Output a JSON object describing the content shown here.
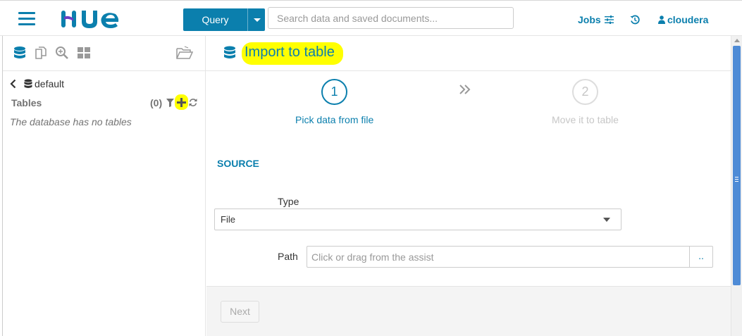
{
  "nav": {
    "query_label": "Query",
    "search_placeholder": "Search data and saved documents...",
    "jobs_label": "Jobs",
    "user_name": "cloudera"
  },
  "assist": {
    "database_name": "default",
    "tables_label": "Tables",
    "tables_count": "(0)",
    "empty_message": "The database has no tables"
  },
  "page": {
    "title": "Import to table"
  },
  "steps": [
    {
      "number": "1",
      "label": "Pick data from file",
      "active": true
    },
    {
      "number": "2",
      "label": "Move it to table",
      "active": false
    }
  ],
  "form": {
    "section_title": "SOURCE",
    "type_label": "Type",
    "type_value": "File",
    "path_label": "Path",
    "path_placeholder": "Click or drag from the assist",
    "browse_label": ".."
  },
  "footer": {
    "next_label": "Next"
  },
  "colors": {
    "accent": "#0b7fad",
    "highlight": "#ffff00",
    "logo_purple": "#6a3fc4",
    "scrollbar_thumb": "#4e8bd6"
  }
}
